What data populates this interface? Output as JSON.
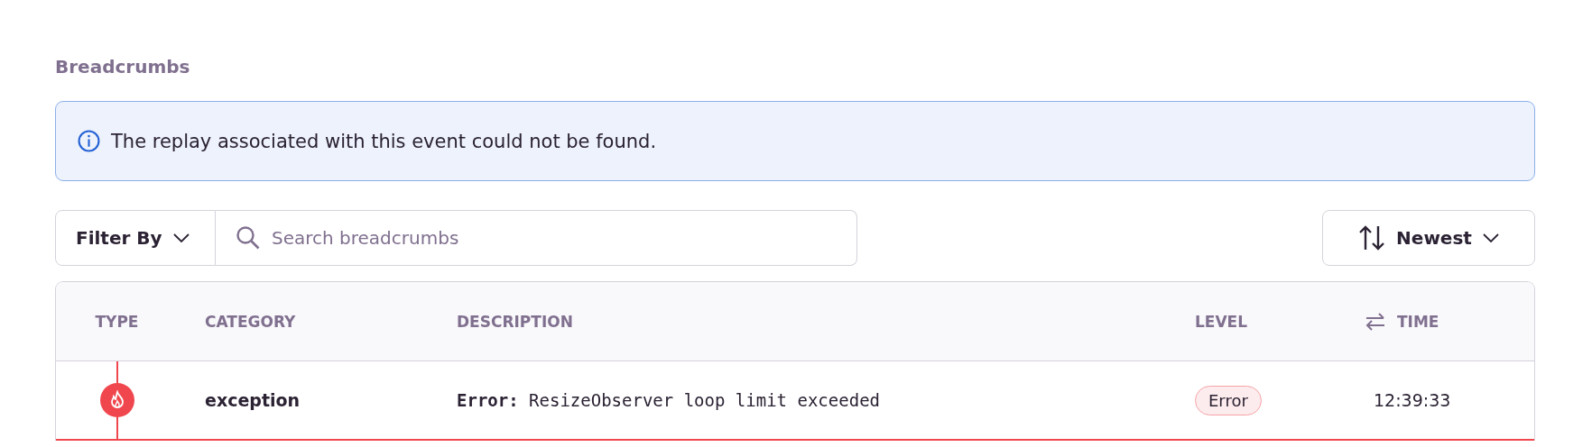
{
  "section": {
    "title": "Breadcrumbs"
  },
  "alert": {
    "kind": "info",
    "message": "The replay associated with this event could not be found."
  },
  "toolbar": {
    "filter": {
      "label": "Filter By"
    },
    "search": {
      "placeholder": "Search breadcrumbs"
    },
    "sort": {
      "label": "Newest"
    }
  },
  "table": {
    "columns": [
      {
        "label": "TYPE"
      },
      {
        "label": "CATEGORY"
      },
      {
        "label": "DESCRIPTION"
      },
      {
        "label": "LEVEL"
      },
      {
        "label": "TIME",
        "kind": "toggle"
      }
    ],
    "rows": [
      {
        "kind": "error",
        "category": "exception",
        "description": "**Error:** ResizeObserver loop limit exceeded",
        "level_label": "Error",
        "time": "12:39:33"
      }
    ]
  }
}
